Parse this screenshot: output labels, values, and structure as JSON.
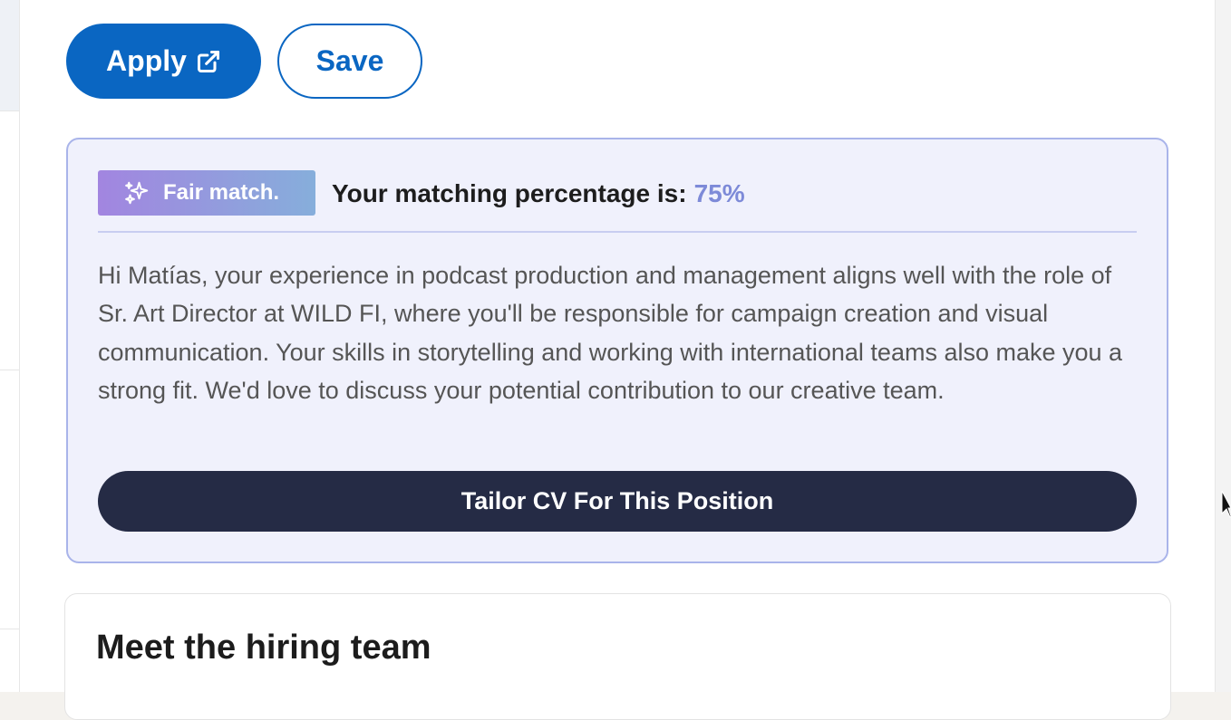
{
  "actions": {
    "apply_label": "Apply",
    "save_label": "Save"
  },
  "match": {
    "badge_label": "Fair match.",
    "heading_prefix": "Your matching percentage is:",
    "percentage": "75%",
    "description": "Hi Matías, your experience in podcast production and management aligns well with the role of Sr. Art Director at WILD FI, where you'll be responsible for campaign creation and visual communication. Your skills in storytelling and working with international teams also make you a strong fit. We'd love to discuss your potential contribution to our creative team.",
    "tailor_button_label": "Tailor CV For This Position"
  },
  "hiring_team": {
    "title": "Meet the hiring team"
  },
  "icons": {
    "apply": "external-link-icon",
    "badge": "sparkles-icon"
  },
  "colors": {
    "primary": "#0a66c2",
    "match_accent": "#7d8ad8",
    "tailor_button": "#252b45",
    "card_background": "#f0f1fc"
  }
}
